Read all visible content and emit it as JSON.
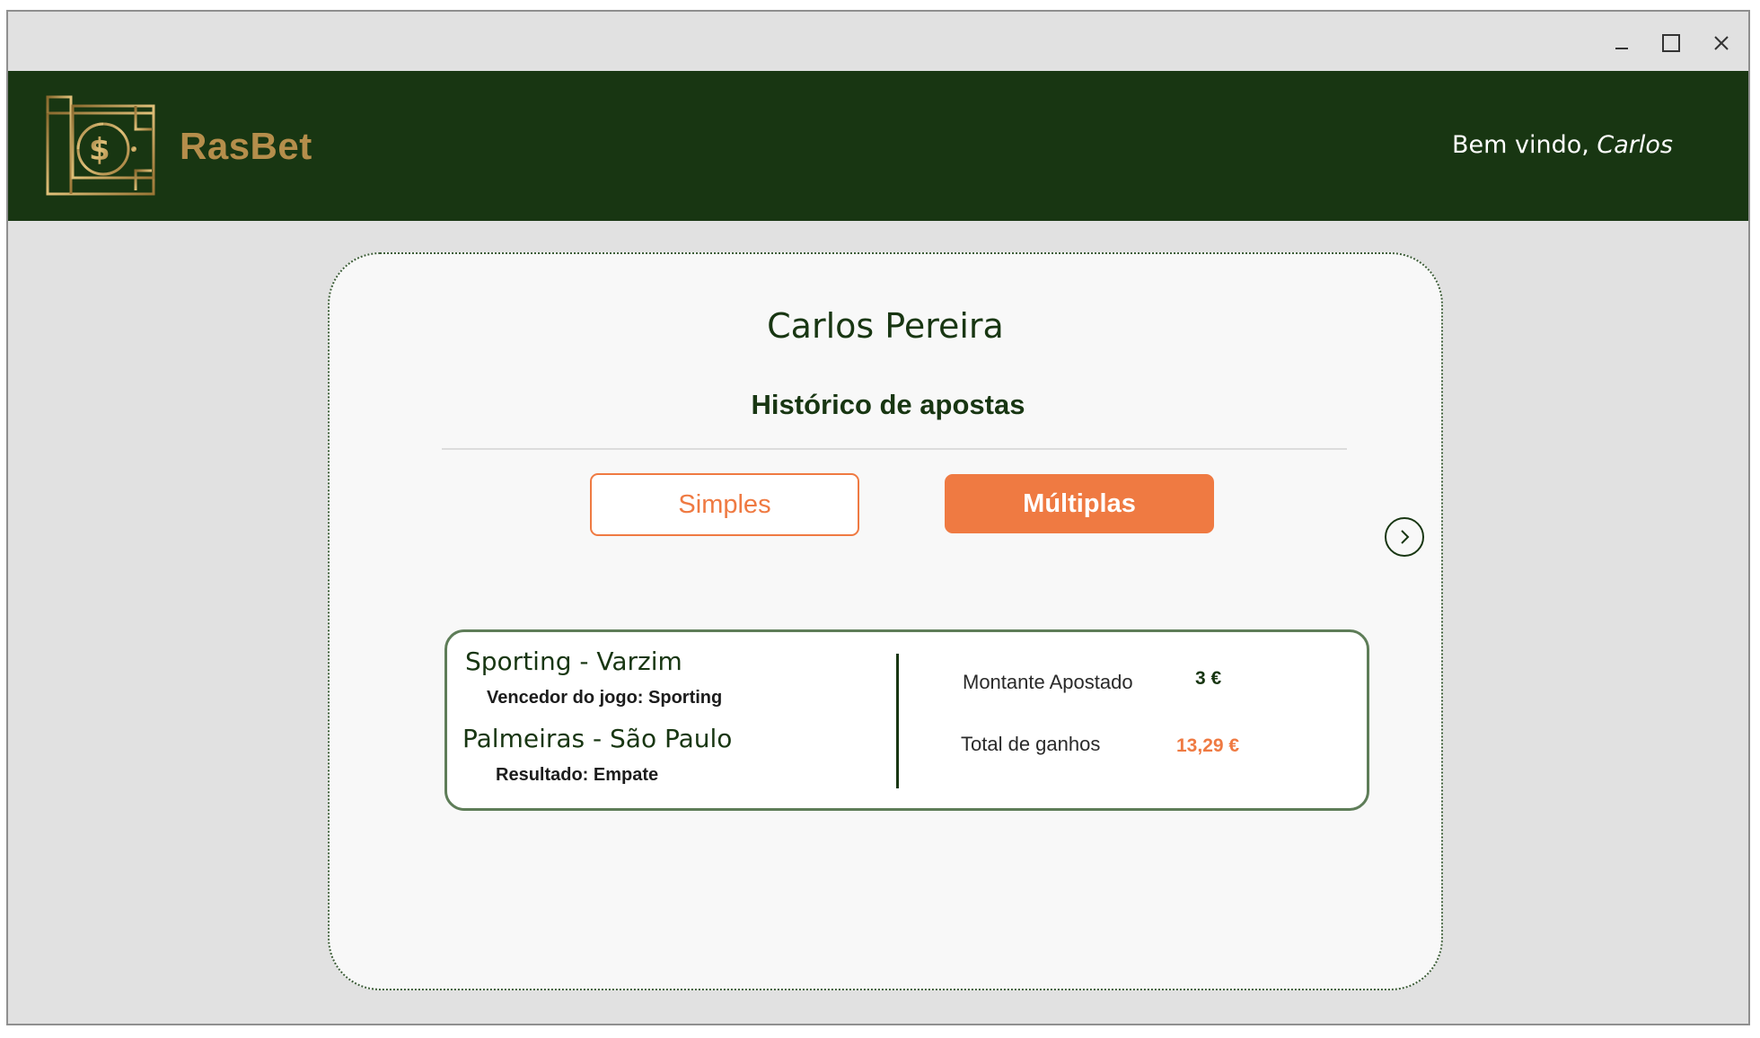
{
  "header": {
    "brand": "RasBet",
    "welcome_prefix": "Bem vindo,",
    "welcome_name": "Carlos"
  },
  "profile": {
    "name": "Carlos Pereira",
    "history_title": "Histórico de apostas"
  },
  "tabs": {
    "simples": "Simples",
    "multiplas": "Múltiplas",
    "active": "multiplas"
  },
  "bet": {
    "selections": [
      {
        "match": "Sporting - Varzim",
        "pick": "Vencedor do jogo: Sporting"
      },
      {
        "match": "Palmeiras - São Paulo",
        "pick": "Resultado: Empate"
      }
    ],
    "amount_label": "Montante Apostado",
    "amount_value": "3 €",
    "total_label": "Total de ganhos",
    "total_value": "13,29 €"
  },
  "colors": {
    "header_bg": "#183612",
    "brand_gold": "#b58e4b",
    "accent_orange": "#ef7a42",
    "window_bg": "#e1e1e1",
    "panel_bg": "#f8f8f8"
  },
  "icons": {
    "logo": "money-bill-icon",
    "next": "chevron-right-icon",
    "minimize": "minimize-icon",
    "maximize": "maximize-icon",
    "close": "close-icon"
  }
}
